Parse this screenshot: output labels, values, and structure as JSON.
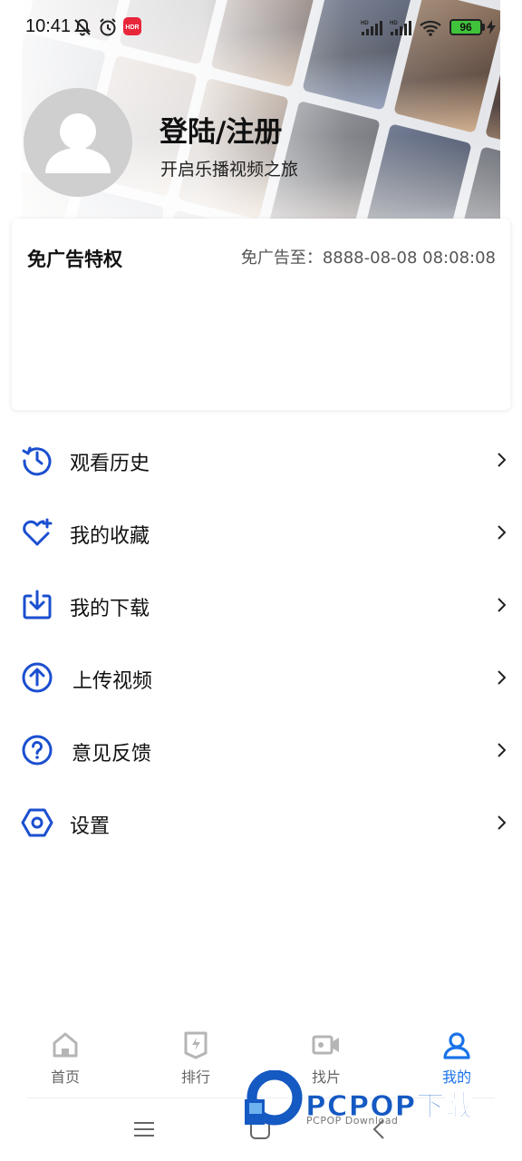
{
  "status_bar": {
    "time": "10:41",
    "battery": "96",
    "notification_app_label": "HDR"
  },
  "profile": {
    "login_title": "登陆/注册",
    "subtitle": "开启乐播视频之旅"
  },
  "ad_free": {
    "title": "免广告特权",
    "expiry": "免广告至：8888-08-08 08:08:08"
  },
  "menu": [
    {
      "label": "观看历史",
      "icon": "history-icon"
    },
    {
      "label": "我的收藏",
      "icon": "favorite-heart-icon"
    },
    {
      "label": "我的下载",
      "icon": "download-icon"
    },
    {
      "label": "上传视频",
      "icon": "upload-icon"
    },
    {
      "label": "意见反馈",
      "icon": "feedback-question-icon"
    },
    {
      "label": "设置",
      "icon": "settings-hexagon-icon"
    }
  ],
  "bottom_nav": [
    {
      "label": "首页",
      "icon": "home-icon",
      "active": false
    },
    {
      "label": "排行",
      "icon": "ranking-icon",
      "active": false
    },
    {
      "label": "找片",
      "icon": "video-camera-icon",
      "active": false
    },
    {
      "label": "我的",
      "icon": "user-icon",
      "active": true
    }
  ],
  "watermark": {
    "title": "PCPOP下载",
    "subtitle": "PCPOP Download"
  },
  "colors": {
    "accent": "#1a73e8",
    "icon_blue": "#1b4fd0",
    "battery_green": "#3fc33a",
    "watermark_blue": "#1559c2"
  }
}
